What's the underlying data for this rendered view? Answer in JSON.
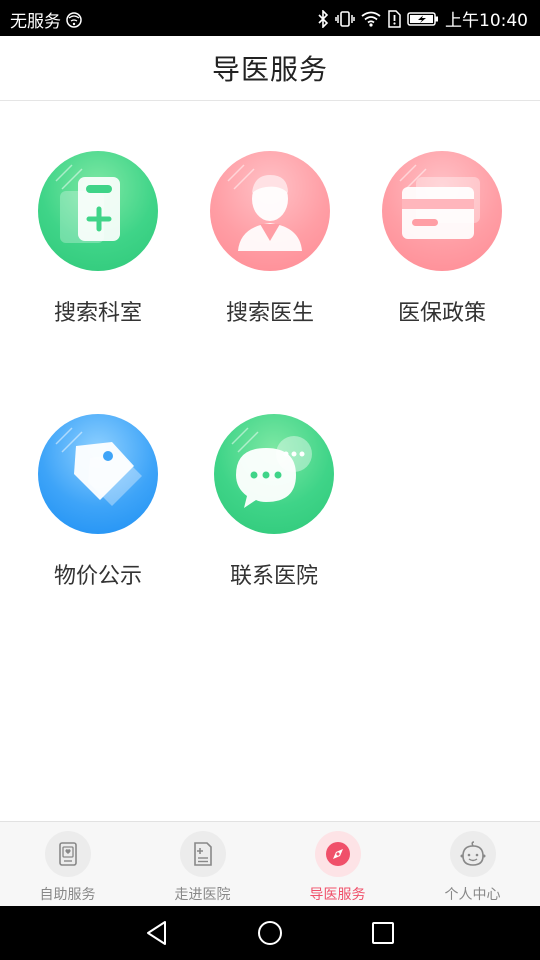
{
  "status_bar": {
    "carrier": "无服务",
    "time": "上午10:40",
    "icons": [
      "no-signal-icon",
      "bluetooth-icon",
      "vibrate-icon",
      "wifi-icon",
      "sim-alert-icon",
      "battery-charging-icon"
    ]
  },
  "header": {
    "title": "导医服务"
  },
  "services": [
    {
      "label": "搜索科室",
      "icon": "department-icon",
      "color": "green"
    },
    {
      "label": "搜索医生",
      "icon": "doctor-icon",
      "color": "pink"
    },
    {
      "label": "医保政策",
      "icon": "insurance-card-icon",
      "color": "pink"
    },
    {
      "label": "物价公示",
      "icon": "price-tag-icon",
      "color": "blue"
    },
    {
      "label": "联系医院",
      "icon": "chat-bubbles-icon",
      "color": "green"
    }
  ],
  "bottom_nav": {
    "items": [
      {
        "label": "自助服务",
        "icon": "self-service-icon",
        "active": false
      },
      {
        "label": "走进医院",
        "icon": "hospital-info-icon",
        "active": false
      },
      {
        "label": "导医服务",
        "icon": "compass-icon",
        "active": true
      },
      {
        "label": "个人中心",
        "icon": "baby-face-icon",
        "active": false
      }
    ]
  },
  "system_nav": {
    "icons": [
      "back-icon",
      "home-icon",
      "recents-icon"
    ]
  },
  "colors": {
    "active": "#f0506a",
    "inactive": "#888888",
    "green": "#3fd488",
    "pink": "#ff9ea5",
    "blue": "#3ea4f8"
  }
}
